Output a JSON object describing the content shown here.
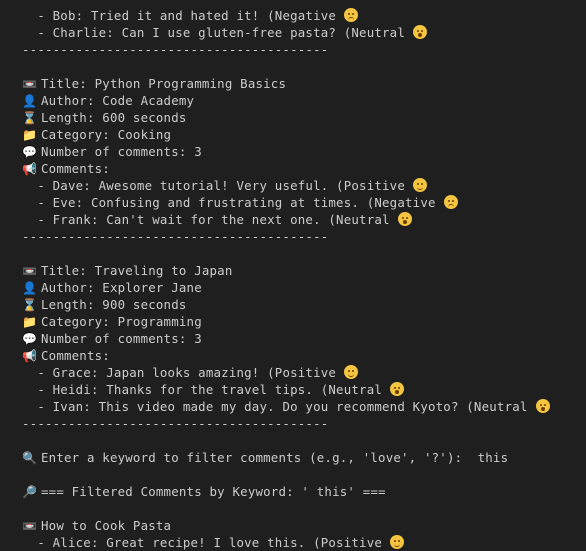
{
  "comment_lines_top": [
    {
      "text": "- Bob: Tried it and hated it! (Negative",
      "sentiment": "negative"
    },
    {
      "text": "- Charlie: Can I use gluten-free pasta? (Neutral",
      "sentiment": "neutral"
    }
  ],
  "divider": "----------------------------------------",
  "videos": [
    {
      "title_line": "Title: Python Programming Basics",
      "author_line": "Author: Code Academy",
      "length_line": "Length: 600 seconds",
      "category_line": "Category: Cooking",
      "count_line": "Number of comments: 3",
      "comments_header": "Comments:",
      "comments": [
        {
          "text": "- Dave: Awesome tutorial! Very useful. (Positive",
          "sentiment": "positive"
        },
        {
          "text": "- Eve: Confusing and frustrating at times. (Negative",
          "sentiment": "negative"
        },
        {
          "text": "- Frank: Can't wait for the next one. (Neutral",
          "sentiment": "neutral"
        }
      ]
    },
    {
      "title_line": "Title: Traveling to Japan",
      "author_line": "Author: Explorer Jane",
      "length_line": "Length: 900 seconds",
      "category_line": "Category: Programming",
      "count_line": "Number of comments: 3",
      "comments_header": "Comments:",
      "comments": [
        {
          "text": "- Grace: Japan looks amazing! (Positive",
          "sentiment": "positive"
        },
        {
          "text": "- Heidi: Thanks for the travel tips. (Neutral",
          "sentiment": "neutral"
        },
        {
          "text": "- Ivan: This video made my day. Do you recommend Kyoto? (Neutral",
          "sentiment": "neutral"
        }
      ]
    }
  ],
  "prompt_line": "Enter a keyword to filter comments (e.g., 'love', '?'):  this",
  "filtered_header": "=== Filtered Comments by Keyword: ' this' ===",
  "filtered_video_title": "How to Cook Pasta",
  "filtered_comments": [
    {
      "text": "- Alice: Great recipe! I love this. (Positive",
      "sentiment": "positive"
    }
  ],
  "icons": {
    "title": "video-camera-icon",
    "author": "person-icon",
    "length": "hourglass-icon",
    "category": "folder-icon",
    "count": "speech-bubble-icon",
    "comments": "megaphone-icon",
    "search": "magnifier-icon",
    "filter": "magnifier-right-icon"
  },
  "colors": {
    "background": "#1f1f1f",
    "text": "#cccccc",
    "emoji": "#f5c542"
  }
}
